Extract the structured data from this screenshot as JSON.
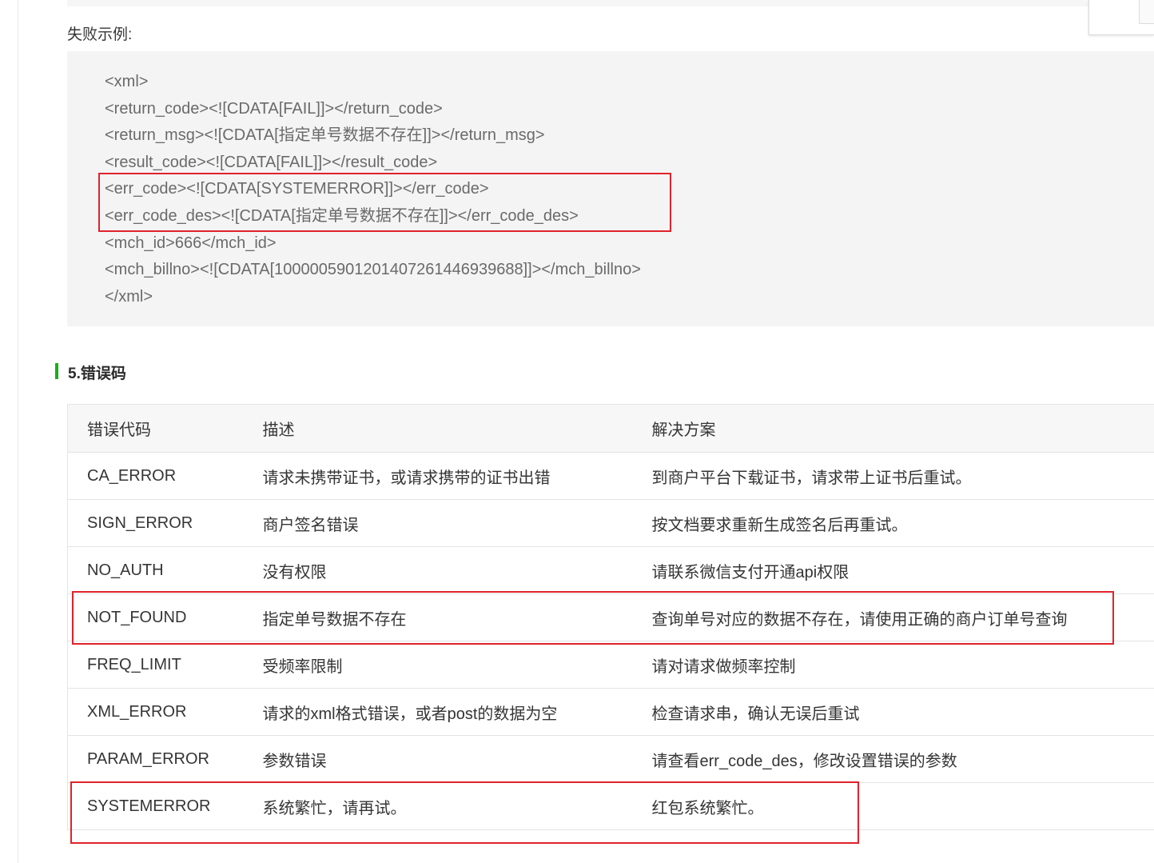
{
  "fail_example_label": "失败示例:",
  "code_lines": [
    "<xml>",
    "<return_code><![CDATA[FAIL]]></return_code>",
    "<return_msg><![CDATA[指定单号数据不存在]]></return_msg>",
    "<result_code><![CDATA[FAIL]]></result_code>",
    "<err_code><![CDATA[SYSTEMERROR]]></err_code>",
    "<err_code_des><![CDATA[指定单号数据不存在]]></err_code_des>",
    "<mch_id>666</mch_id>",
    "<mch_billno><![CDATA[1000005901201407261446939688]]></mch_billno>",
    "</xml>"
  ],
  "section": {
    "title": "5.错误码",
    "accent": "#1aad19"
  },
  "table": {
    "headers": [
      "错误代码",
      "描述",
      "解决方案"
    ],
    "rows": [
      [
        "CA_ERROR",
        "请求未携带证书，或请求携带的证书出错",
        "到商户平台下载证书，请求带上证书后重试。"
      ],
      [
        "SIGN_ERROR",
        "商户签名错误",
        "按文档要求重新生成签名后再重试。"
      ],
      [
        "NO_AUTH",
        "没有权限",
        "请联系微信支付开通api权限"
      ],
      [
        "NOT_FOUND",
        "指定单号数据不存在",
        "查询单号对应的数据不存在，请使用正确的商户订单号查询"
      ],
      [
        "FREQ_LIMIT",
        "受频率限制",
        "请对请求做频率控制"
      ],
      [
        "XML_ERROR",
        "请求的xml格式错误，或者post的数据为空",
        "检查请求串，确认无误后重试"
      ],
      [
        "PARAM_ERROR",
        "参数错误",
        "请查看err_code_des，修改设置错误的参数"
      ],
      [
        "SYSTEMERROR",
        "系统繁忙，请再试。",
        "红包系统繁忙。"
      ]
    ]
  },
  "highlight_color": "#e0222b"
}
